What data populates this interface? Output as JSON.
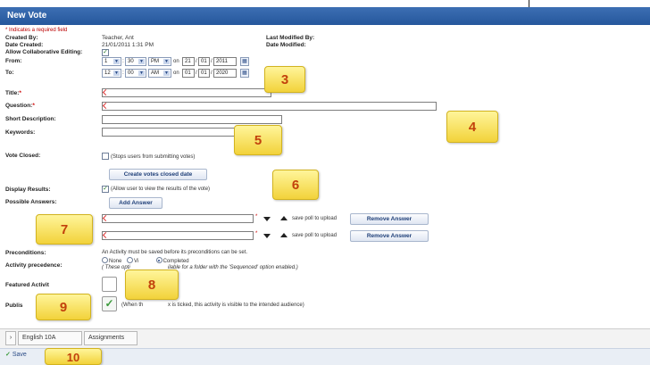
{
  "window": {
    "title": "New Vote"
  },
  "form": {
    "required_note": "* Indicates a required field",
    "created_by_label": "Created By:",
    "created_by_value": "Teacher, Ant",
    "last_modified_by_label": "Last Modified By:",
    "date_created_label": "Date Created:",
    "date_created_value": "21/01/2011 1:31 PM",
    "date_modified_label": "Date Modified:",
    "collab_label": "Allow Collaborative Editing:",
    "from_label": "From:",
    "from": {
      "hour": "1",
      "minute": "30",
      "ampm": "PM",
      "on": "on",
      "day": "21",
      "month": "01",
      "year": "2011"
    },
    "to_label": "To:",
    "to": {
      "hour": "12",
      "minute": "00",
      "ampm": "AM",
      "on": "on",
      "day": "01",
      "month": "01",
      "year": "2020"
    },
    "title_label": "Title:",
    "question_label": "Question:",
    "short_desc_label": "Short Description:",
    "keywords_label": "Keywords:",
    "vote_closed_label": "Vote Closed:",
    "vote_closed_note": "(Stops users from submitting votes)",
    "create_closed_date_button": "Create votes closed date",
    "display_results_label": "Display Results:",
    "display_results_note": "(Allow user to view the results of the vote)",
    "possible_answers_label": "Possible Answers:",
    "add_answer_button": "Add Answer",
    "save_poll_text": "save poll to upload",
    "remove_answer_button": "Remove Answer",
    "preconditions_label": "Preconditions:",
    "preconditions_note": "An Activity must be saved before its preconditions can be set.",
    "activity_precedence_label": "Activity precedence:",
    "radio_none": "None",
    "radio_viewed": "Vi",
    "radio_completed": "Completed",
    "precedence_note_start": "( These opti",
    "precedence_note_end": "ilable for a folder with the 'Sequenced' option enabled.)",
    "featured_label": "Featured Activit",
    "publish_label": "Publis",
    "publish_note_start": "(When th",
    "publish_note_end": "x is ticked, this activity is visible to the intended audience)"
  },
  "bottom": {
    "tab_course": "English 10A",
    "tab_assignments": "Assignments",
    "save_label": "Save"
  },
  "callouts": [
    "3",
    "4",
    "5",
    "6",
    "7",
    "8",
    "9",
    "10"
  ],
  "colors": {
    "title_bar": "#25579c",
    "callout_fill": "#f2d23a",
    "callout_text": "#c2410c"
  }
}
